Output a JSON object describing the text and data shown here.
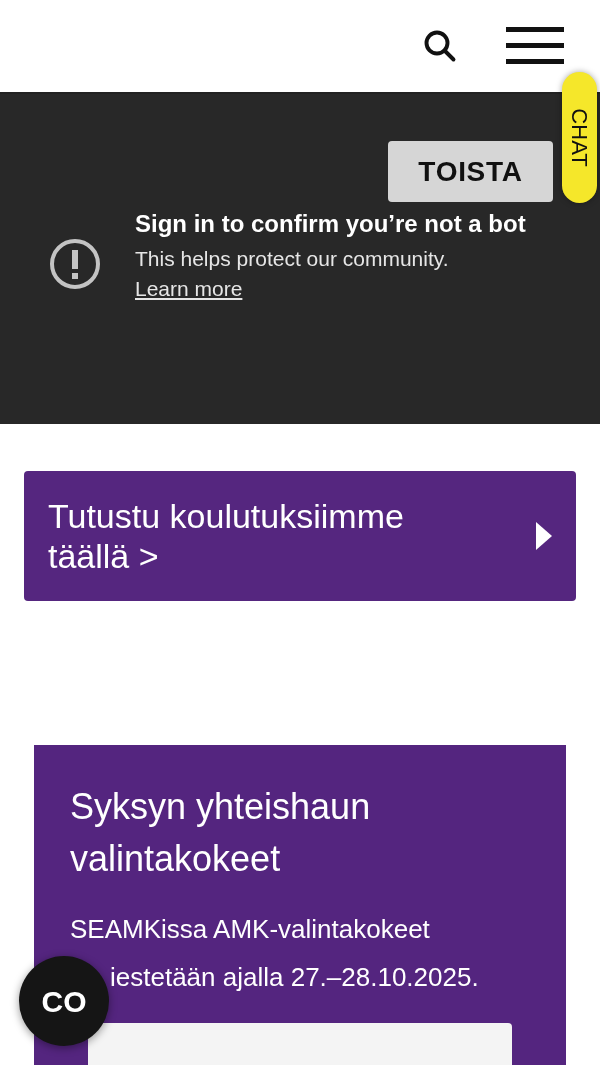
{
  "chat_tab": {
    "label": "CHAT"
  },
  "video": {
    "play_button": "TOISTA",
    "title": "Sign in to confirm you’re not a bot",
    "message": "This helps protect our community.",
    "link": "Learn more"
  },
  "banner": {
    "label": "Tutustu koulutuksiimme täällä >"
  },
  "card": {
    "title": "Syksyn yhteishaun valintakokeet",
    "lines": [
      "SEAMKissa AMK-valintakokeet",
      "iestetään ajalla 27.–28.10.2025."
    ]
  },
  "floating_button": {
    "label": "CO"
  }
}
